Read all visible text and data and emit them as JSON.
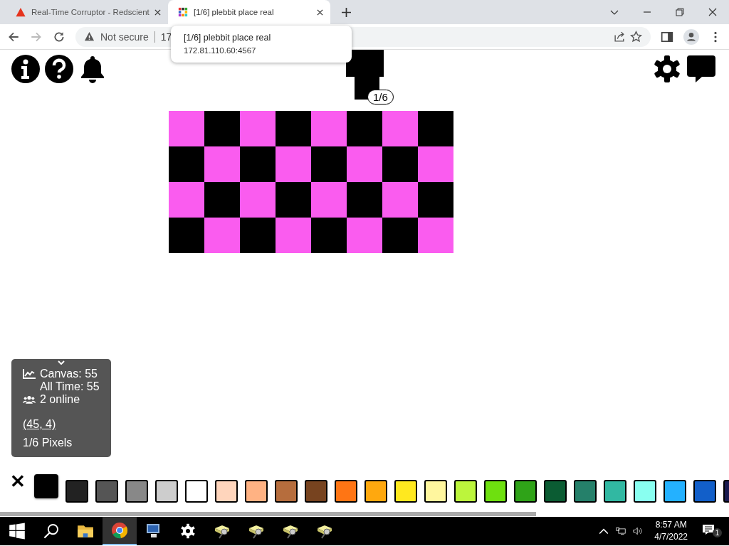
{
  "browser": {
    "tabs": [
      {
        "title": "Real-Time Corruptor - Redscient",
        "selected": false
      },
      {
        "title": "[1/6] plebbit place real",
        "selected": true
      }
    ],
    "address": {
      "security": "Not secure",
      "url_visible": "17"
    },
    "tooltip": {
      "title": "[1/6] plebbit place real",
      "url": "172.81.110.60:4567"
    }
  },
  "cursor": {
    "badge": "1/6"
  },
  "canvas": {
    "rows": [
      {
        "cells": [
          {
            "color": "#fa5cef"
          },
          {
            "color": "#000000"
          },
          {
            "color": "#fa5cef"
          },
          {
            "color": "#000000"
          },
          {
            "color": "#fa5cef"
          },
          {
            "color": "#000000"
          },
          {
            "color": "#fa5cef"
          },
          {
            "color": "#000000"
          }
        ]
      },
      {
        "cells": [
          {
            "color": "#000000"
          },
          {
            "color": "#fa5cef"
          },
          {
            "color": "#000000"
          },
          {
            "color": "#fa5cef"
          },
          {
            "color": "#000000"
          },
          {
            "color": "#fa5cef"
          },
          {
            "color": "#000000"
          },
          {
            "color": "#fa5cef"
          }
        ]
      },
      {
        "cells": [
          {
            "color": "#fa5cef"
          },
          {
            "color": "#000000"
          },
          {
            "color": "#fa5cef"
          },
          {
            "color": "#000000"
          },
          {
            "color": "#fa5cef"
          },
          {
            "color": "#000000"
          },
          {
            "color": "#fa5cef"
          },
          {
            "color": "#000000"
          }
        ]
      },
      {
        "cells": [
          {
            "color": "#000000"
          },
          {
            "color": "#fa5cef"
          },
          {
            "color": "#000000"
          },
          {
            "color": "#fa5cef"
          },
          {
            "color": "#000000"
          },
          {
            "color": "#fa5cef"
          },
          {
            "color": "#000000"
          },
          {
            "color": "#fa5cef"
          }
        ]
      }
    ]
  },
  "stats": {
    "canvas": "Canvas: 55",
    "all_time": "All Time: 55",
    "online": "2 online",
    "coords": "(45, 4)",
    "pixels": "1/6 Pixels"
  },
  "palette": {
    "close": "✕",
    "colors": [
      {
        "color": "#000000",
        "selected": true
      },
      {
        "color": "#222222",
        "selected": false
      },
      {
        "color": "#555555",
        "selected": false
      },
      {
        "color": "#888888",
        "selected": false
      },
      {
        "color": "#cdcdcd",
        "selected": false
      },
      {
        "color": "#ffffff",
        "selected": false
      },
      {
        "color": "#ffd5bc",
        "selected": false
      },
      {
        "color": "#ffb283",
        "selected": false
      },
      {
        "color": "#b66d3d",
        "selected": false
      },
      {
        "color": "#77431f",
        "selected": false
      },
      {
        "color": "#ff7514",
        "selected": false
      },
      {
        "color": "#ffa80e",
        "selected": false
      },
      {
        "color": "#ffe81f",
        "selected": false
      },
      {
        "color": "#fff69e",
        "selected": false
      },
      {
        "color": "#bcf53c",
        "selected": false
      },
      {
        "color": "#6ee00f",
        "selected": false
      },
      {
        "color": "#2fa318",
        "selected": false
      },
      {
        "color": "#0b5c33",
        "selected": false
      },
      {
        "color": "#25806a",
        "selected": false
      },
      {
        "color": "#31b8a2",
        "selected": false
      },
      {
        "color": "#89fff0",
        "selected": false
      },
      {
        "color": "#24b1ff",
        "selected": false
      },
      {
        "color": "#125fc9",
        "selected": false
      },
      {
        "color": "#1a1a4f",
        "selected": false
      }
    ]
  },
  "taskbar": {
    "time": "8:57 AM",
    "date": "4/7/2022",
    "notifications": "1"
  }
}
